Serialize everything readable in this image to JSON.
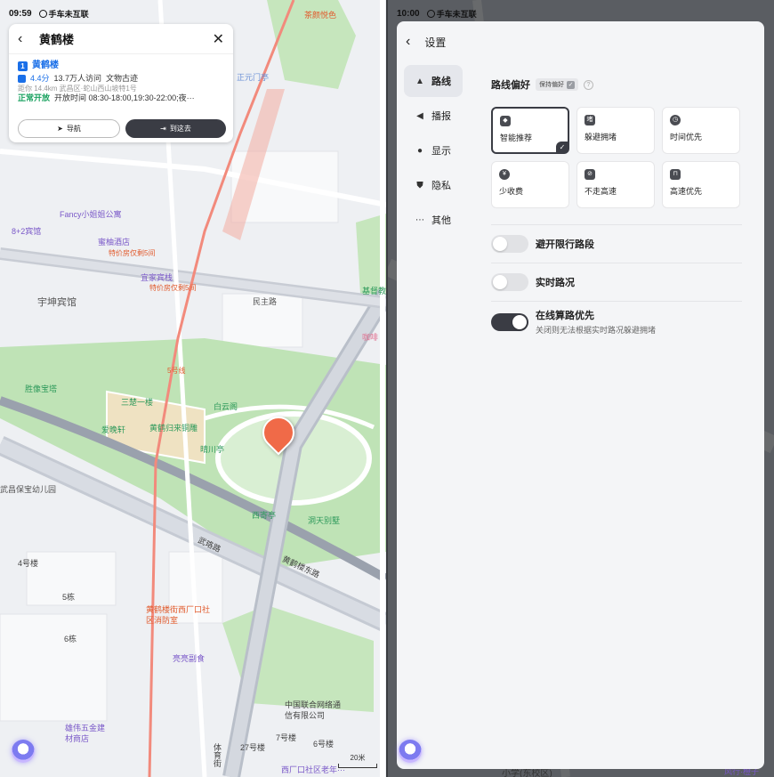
{
  "left": {
    "status": {
      "time": "09:59",
      "network": "手车未互联"
    },
    "poi_card": {
      "title": "黄鹤楼",
      "index": "1",
      "name": "黄鹤楼",
      "rating": "4.4分",
      "visits": "13.7万人访问",
      "category": "文物古迹",
      "hidden_line": "距你 14.4km 武昌区·蛇山西山坡特1号",
      "status": "正常开放",
      "hours": "开放时间 08:30-18:00,19:30-22:00;夜···",
      "nav_label": "导航",
      "go_label": "到这去"
    },
    "map_labels": {
      "poi_guest": "宇坤宾馆",
      "fancy": "Fancy小姐姐公寓",
      "hotel82": "8+2宾馆",
      "peach": "蜜柚酒店",
      "deal1": "特价房仅剩5间",
      "yijia": "宜家宾栈",
      "deal2": "特价房仅剩5间",
      "road_minzhu": "民主路",
      "tower": "胜像宝塔",
      "sanjue": "三楚一楼",
      "baiyun": "白云阁",
      "aitang": "爱晚轩",
      "huanghe_gui": "黄鹤归来铜雕",
      "shunchuan": "晴川亭",
      "xichun": "西寄亭",
      "dongtian": "洞天别墅",
      "kindergarten": "武昌保宝幼儿园",
      "road_wuluo": "武珞路",
      "road_huanghe": "黄鹤楼东路",
      "bld4": "4号楼",
      "bld5": "5栋",
      "bld6": "6栋",
      "fire_room": "黄鹤楼街西厂口社区消防室",
      "xiaoxiao": "亮亮副食",
      "hardware": "雄伟五金建材商店",
      "unicom": "中国联合网络通信有限公司",
      "bld7": "7号楼",
      "bld27": "27号楼",
      "bld6b": "6号楼",
      "sports": "体育街",
      "xichang": "西厂口社区老年···",
      "teahouse": "茶颜悦色",
      "zhengyuan": "正元门亭",
      "road5": "5号线",
      "jianshu": "基督教",
      "huiran": "咖啡"
    },
    "scale": "20米"
  },
  "right": {
    "status": {
      "time": "10:00",
      "network": "手车未互联"
    },
    "title": "设置",
    "sidebar": [
      {
        "label": "路线",
        "icon": "navigation-arrow-icon",
        "active": true
      },
      {
        "label": "播报",
        "icon": "speaker-icon",
        "active": false
      },
      {
        "label": "显示",
        "icon": "location-pin-icon",
        "active": false
      },
      {
        "label": "隐私",
        "icon": "shield-icon",
        "active": false
      },
      {
        "label": "其他",
        "icon": "more-dots-icon",
        "active": false
      }
    ],
    "route_pref": {
      "heading": "路线偏好",
      "keep_label": "保持偏好",
      "options": [
        {
          "label": "智能推荐",
          "icon": "smart-icon",
          "selected": true
        },
        {
          "label": "躲避拥堵",
          "icon": "avoid-jam-icon",
          "selected": false
        },
        {
          "label": "时间优先",
          "icon": "clock-icon",
          "selected": false
        },
        {
          "label": "少收费",
          "icon": "coin-icon",
          "selected": false
        },
        {
          "label": "不走高速",
          "icon": "no-highway-icon",
          "selected": false
        },
        {
          "label": "高速优先",
          "icon": "highway-icon",
          "selected": false
        }
      ]
    },
    "toggles": [
      {
        "label": "避开限行路段",
        "sub": "",
        "on": false
      },
      {
        "label": "实时路况",
        "sub": "",
        "on": false
      },
      {
        "label": "在线算路优先",
        "sub": "关闭则无法根据实时路况躲避拥堵",
        "on": true
      }
    ],
    "bg_labels": {
      "school": "小学(东校区)",
      "wind": "风行·橙子"
    }
  }
}
